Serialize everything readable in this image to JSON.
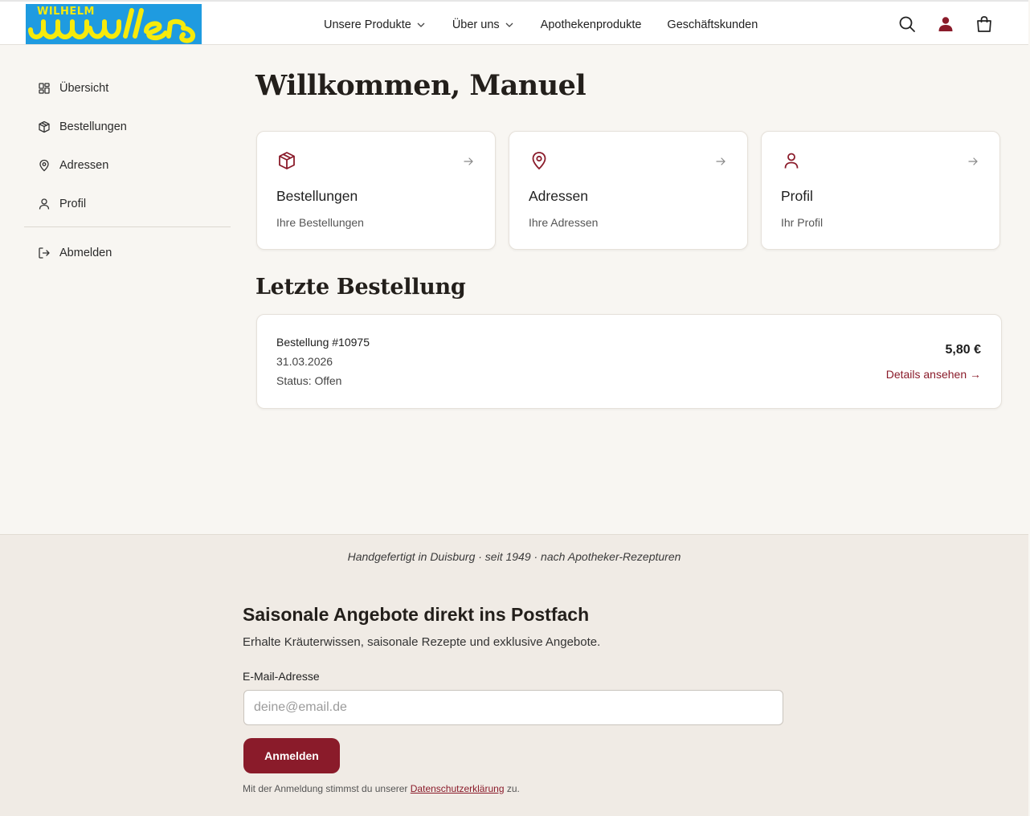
{
  "header": {
    "logo_text_top": "WILHELM",
    "logo_text_main": "müller",
    "nav": [
      {
        "label": "Unsere Produkte",
        "has_dropdown": true
      },
      {
        "label": "Über uns",
        "has_dropdown": true
      },
      {
        "label": "Apothekenprodukte",
        "has_dropdown": false
      },
      {
        "label": "Geschäftskunden",
        "has_dropdown": false
      }
    ],
    "icons": [
      "search-icon",
      "user-icon",
      "shopping-bag-icon"
    ]
  },
  "sidebar": {
    "items": [
      {
        "label": "Übersicht",
        "icon": "grid-icon"
      },
      {
        "label": "Bestellungen",
        "icon": "package-icon"
      },
      {
        "label": "Adressen",
        "icon": "map-pin-icon"
      },
      {
        "label": "Profil",
        "icon": "user-icon"
      }
    ],
    "logout": {
      "label": "Abmelden",
      "icon": "logout-icon"
    }
  },
  "main": {
    "welcome": "Willkommen, Manuel",
    "cards": [
      {
        "title": "Bestellungen",
        "subtitle": "Ihre Bestellungen",
        "icon": "package-icon"
      },
      {
        "title": "Adressen",
        "subtitle": "Ihre Adressen",
        "icon": "map-pin-icon"
      },
      {
        "title": "Profil",
        "subtitle": "Ihr Profil",
        "icon": "user-icon"
      }
    ],
    "last_order_title": "Letzte Bestellung",
    "last_order": {
      "number": "Bestellung #10975",
      "date": "31.03.2026",
      "status": "Status: Offen",
      "price": "5,80 €",
      "details_link": "Details ansehen →"
    }
  },
  "footer": {
    "tagline": "Handgefertigt in Duisburg · seit 1949 · nach Apotheker-Rezepturen",
    "newsletter": {
      "title": "Saisonale Angebote direkt ins Postfach",
      "subtitle": "Erhalte Kräuterwissen, saisonale Rezepte und exklusive Angebote.",
      "label": "E-Mail-Adresse",
      "placeholder": "deine@email.de",
      "button": "Anmelden",
      "note_prefix": "Mit der Anmeldung stimmst du unserer ",
      "note_link": "Datenschutzerklärung",
      "note_suffix": " zu."
    }
  },
  "colors": {
    "accent": "#8a1b2a",
    "logo_bg": "#1f9be0",
    "logo_text": "#f6ea0c",
    "page_bg": "#f8f6f2",
    "footer_bg": "#f0ebe5"
  }
}
